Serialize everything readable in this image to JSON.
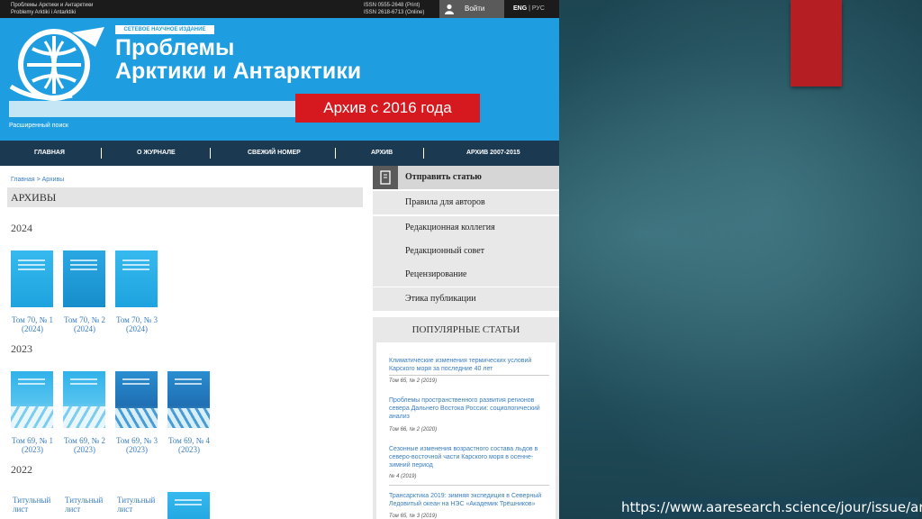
{
  "site": {
    "topbar": {
      "journal_ru": "Проблемы Арктики и Антарктики",
      "journal_en": "Problemy Arktiki i Antarktiki",
      "issn_print": "ISSN 0555-2648 (Print)",
      "issn_online": "ISSN 2618-6713 (Online)",
      "login": "Войти",
      "lang_en": "ENG",
      "lang_sep": "|",
      "lang_ru": "РУС"
    },
    "header": {
      "tagline": "СЕТЕВОЕ НАУЧНОЕ ИЗДАНИЕ",
      "title_line1": "Проблемы",
      "title_line2": "Арктики и Антарктики",
      "search_placeholder": "",
      "advanced_search": "Расширенный поиск"
    },
    "nav": [
      "ГЛАВНАЯ",
      "О ЖУРНАЛЕ",
      "СВЕЖИЙ НОМЕР",
      "АРХИВ",
      "АРХИВ 2007-2015"
    ],
    "breadcrumb": "Главная > Архивы",
    "archives_title": "АРХИВЫ",
    "years": [
      "2024",
      "2023",
      "2022"
    ],
    "issues_2024": [
      "Том 70, № 1 (2024)",
      "Том 70, № 2 (2024)",
      "Том 70, № 3 (2024)"
    ],
    "issues_2023": [
      "Том 69, № 1 (2023)",
      "Том 69, № 2 (2023)",
      "Том 69, № 3 (2023)",
      "Том 69, № 4 (2023)"
    ],
    "issues_2022": [
      "Титульный лист",
      "Титульный лист",
      "Титульный лист"
    ],
    "sidebar": [
      "Отправить статью",
      "Правила для авторов",
      "Редакционная коллегия",
      "Редакционный совет",
      "Рецензирование",
      "Этика публикации"
    ],
    "popular": {
      "heading": "ПОПУЛЯРНЫЕ СТАТЬИ",
      "articles": [
        {
          "title": "Климатические изменения термических условий Карского моря за последние 40 лет",
          "meta": "Том 65, № 2 (2019)"
        },
        {
          "title": "Проблемы пространственного развития регионов севера Дальнего Востока России: социологический анализ",
          "meta": "Том 66, № 2 (2020)"
        },
        {
          "title": "Сезонные изменения возрастного состава льдов в северо-восточной части Карского моря в осенне-зимний период",
          "meta": "№ 4 (2019)"
        },
        {
          "title": "Трансарктика 2019: зимняя экспедиция в Северный Ледовитый океан на НЭС «Академик Трёшников»",
          "meta": "Том 65, № 3 (2019)"
        }
      ]
    }
  },
  "overlay": {
    "archive_label": "Архив с 2016 года",
    "url": "https://www.aaresearch.science/jour/issue/archive"
  },
  "colors": {
    "header_blue": "#1e9ee0",
    "nav_navy": "#1b3a52",
    "label_red": "#d5191e",
    "slide_bg": "#1f4a57",
    "accent_red": "#b51f24"
  }
}
